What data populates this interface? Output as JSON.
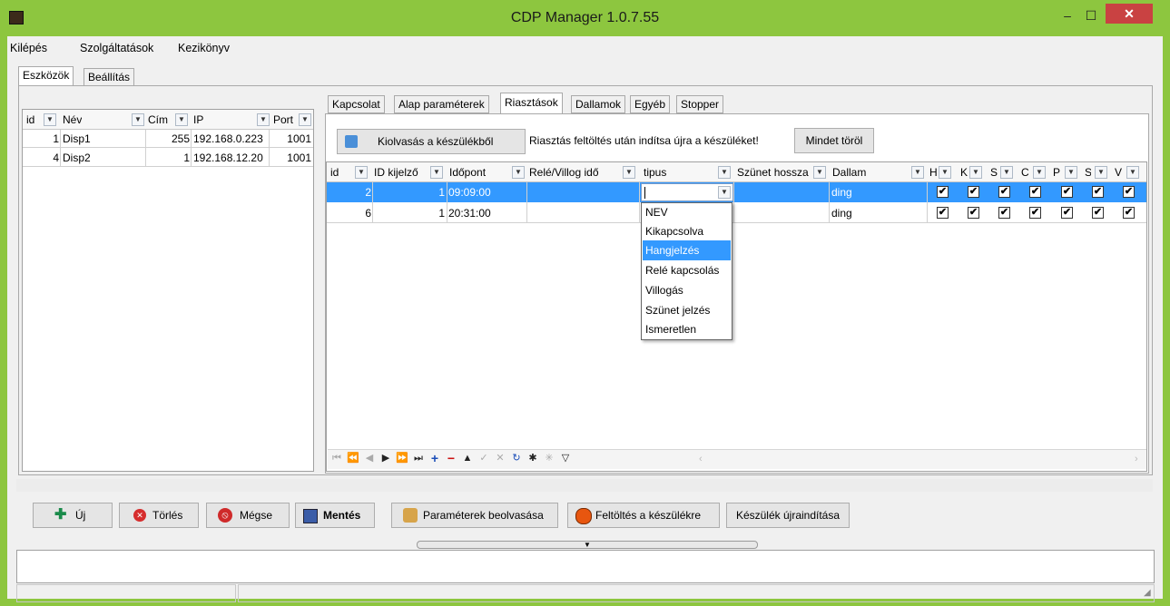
{
  "window": {
    "title": "CDP Manager 1.0.7.55",
    "min": "–",
    "max": "☐",
    "close": "✕"
  },
  "menu": [
    "Kilépés",
    "Szolgáltatások",
    "Kezikönyv"
  ],
  "main_tabs": [
    "Eszközök",
    "Beállítás"
  ],
  "devices": {
    "headers": [
      "id",
      "Név",
      "Cím",
      "IP",
      "Port"
    ],
    "rows": [
      {
        "id": "1",
        "name": "Disp1",
        "cim": "255",
        "ip": "192.168.0.223",
        "port": "1001"
      },
      {
        "id": "4",
        "name": "Disp2",
        "cim": "1",
        "ip": "192.168.12.20",
        "port": "1001"
      }
    ]
  },
  "sub_tabs": [
    "Kapcsolat",
    "Alap paraméterek",
    "Riasztások",
    "Dallamok",
    "Egyéb",
    "Stopper"
  ],
  "alarm": {
    "read_btn": "Kiolvasás a készülékből",
    "notice": "Riasztás feltöltés után indítsa újra a készüléket!",
    "delete_all_btn": "Mindet töröl",
    "headers": [
      "id",
      "ID kijelző",
      "Időpont",
      "Relé/Villog idő",
      "tipus",
      "Szünet hossza",
      "Dallam",
      "H",
      "K",
      "S",
      "C",
      "P",
      "S",
      "V"
    ],
    "rows": [
      {
        "id": "2",
        "display": "1",
        "time": "09:09:00",
        "relay": "",
        "type": "",
        "pause": "",
        "melody": "ding",
        "days": [
          true,
          true,
          true,
          true,
          true,
          true,
          true
        ]
      },
      {
        "id": "6",
        "display": "1",
        "time": "20:31:00",
        "relay": "",
        "type": "",
        "pause": "",
        "melody": "ding",
        "days": [
          true,
          true,
          true,
          true,
          true,
          true,
          true
        ]
      }
    ],
    "type_options": [
      "NEV",
      "Kikapcsolva",
      "Hangjelzés",
      "Relé kapcsolás",
      "Villogás",
      "Szünet jelzés",
      "Ismeretlen"
    ],
    "selected_option": "Hangjelzés"
  },
  "buttons": {
    "new": "Új",
    "delete": "Törlés",
    "cancel": "Mégse",
    "save": "Mentés",
    "read_params": "Paraméterek beolvasása",
    "upload": "Feltöltés a készülékre",
    "restart": "Készülék újraindítása"
  },
  "colors": {
    "titlebar": "#8dc63f",
    "selection": "#3399ff",
    "close": "#c94242"
  }
}
